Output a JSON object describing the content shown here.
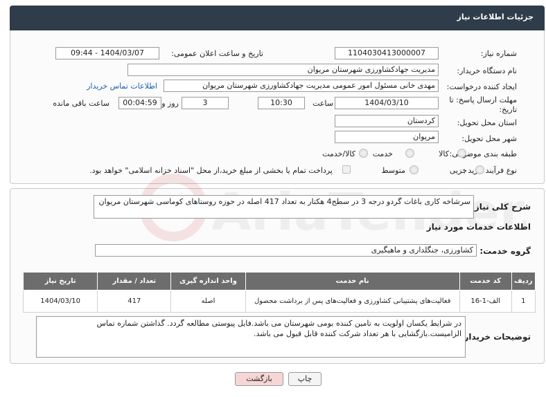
{
  "header": {
    "title": "جزئیات اطلاعات نیاز"
  },
  "form": {
    "need_number_label": "شماره نیاز:",
    "need_number": "1104030413000007",
    "announce_label": "تاریخ و ساعت اعلان عمومی:",
    "announce_value": "1404/03/07 - 09:44",
    "buyer_org_label": "نام دستگاه خریدار:",
    "buyer_org": "مدیریت جهادکشاورزی شهرستان مریوان",
    "creator_label": "ایجاد کننده درخواست:",
    "creator": "مهدی خانی مسئول امور عمومی مدیریت جهادکشاورزی شهرستان مریوان",
    "contact_link": "اطلاعات تماس خریدار",
    "deadline_label_1": "مهلت ارسال پاسخ: تا",
    "deadline_label_2": "تاریخ:",
    "deadline_date": "1404/03/10",
    "time_label": "ساعت",
    "deadline_time": "10:30",
    "days_value": "3",
    "days_label": "روز و",
    "remaining_time": "00:04:59",
    "remaining_label": "ساعت باقی مانده",
    "province_label": "استان محل تحویل:",
    "province": "کردستان",
    "city_label": "شهر محل تحویل:",
    "city": "مریوان",
    "category_label": "طبقه بندی موضوعی:",
    "category_options": [
      "کالا",
      "خدمت",
      "کالا/خدمت"
    ],
    "process_label": "نوع فرآیند خرید :",
    "process_options": [
      "جزیی",
      "متوسط"
    ],
    "payment_note": "پرداخت تمام یا بخشی از مبلغ خرید،از محل \"اسناد خزانه اسلامی\" خواهد بود."
  },
  "summary": {
    "label": "شرح کلی نیاز:",
    "text": "سرشاخه کاری باغات گردو درجه 3 در سطح4 هکتار به تعداد 417 اصله در حوزه روستاهای کوماسی شهرستان مریوان"
  },
  "services": {
    "section_title": "اطلاعات خدمات مورد نیاز",
    "group_label": "گروه خدمت:",
    "group_value": "کشاورزی، جنگلداری و ماهیگیری",
    "columns": [
      "ردیف",
      "کد خدمت",
      "نام خدمت",
      "واحد اندازه گیری",
      "تعداد / مقدار",
      "تاریخ نیاز"
    ],
    "rows": [
      [
        "1",
        "الف-1-16",
        "فعالیت‌های پشتیبانی کشاورزی و فعالیت‌های پس از برداشت محصول",
        "اصله",
        "417",
        "1404/03/10"
      ]
    ]
  },
  "buyer_notes": {
    "label": "توضیحات خریدار:",
    "text": "در شرایط یکسان اولویت به تامین کننده بومی شهرستان می باشد.فایل پیوستی مطالعه گردد. گذاشتن شماره تماس الزامیست.بازگشایی با هر تعداد شرکت کننده قابل قبول می باشد."
  },
  "buttons": {
    "print": "چاپ",
    "back": "بازگشت"
  },
  "watermark": "AriaTender.neT",
  "colors": {
    "header_bg": "#2e3d49",
    "table_header_bg": "#6d6d6d",
    "back_button_bg": "#f6d6d6",
    "link": "#1a5fb4"
  }
}
